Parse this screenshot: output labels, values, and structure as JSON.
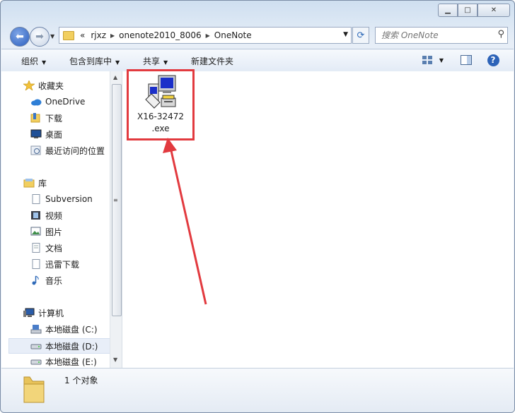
{
  "window": {
    "caption_buttons": [
      "minimize",
      "maximize",
      "close"
    ]
  },
  "address_bar": {
    "overflow": "«",
    "segments": [
      "rjxz",
      "onenote2010_8006",
      "OneNote"
    ]
  },
  "search": {
    "placeholder": "搜索 OneNote"
  },
  "toolbar": {
    "organize": "组织",
    "include_library": "包含到库中",
    "share": "共享",
    "new_folder": "新建文件夹"
  },
  "nav": {
    "favorites": {
      "header": "收藏夹",
      "items": [
        "OneDrive",
        "下载",
        "桌面",
        "最近访问的位置"
      ]
    },
    "libraries": {
      "header": "库",
      "items": [
        "Subversion",
        "视频",
        "图片",
        "文档",
        "迅雷下载",
        "音乐"
      ]
    },
    "computer": {
      "header": "计算机",
      "items": [
        "本地磁盘 (C:)",
        "本地磁盘 (D:)",
        "本地磁盘 (E:)"
      ],
      "selected": "本地磁盘 (D:)"
    }
  },
  "files": [
    {
      "name_line1": "X16-32472",
      "name_line2": ".exe",
      "icon": "installer-exe-icon",
      "highlighted": true
    }
  ],
  "status": {
    "item_count": "1 个对象"
  },
  "colors": {
    "highlight": "#e23a3f",
    "accent": "#2d63b8"
  }
}
